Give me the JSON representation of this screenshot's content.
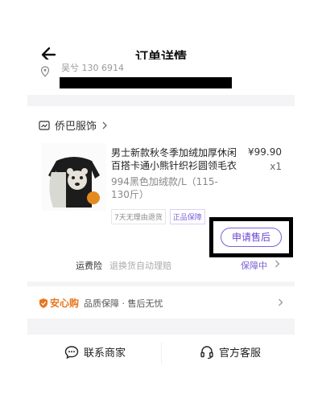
{
  "header": {
    "title": "订单详情"
  },
  "address": {
    "line": "吴兮 130 6914"
  },
  "store": {
    "name": "侨巴服饰"
  },
  "product": {
    "title": "男士新款秋冬季加绒加厚休闲百搭卡通小熊针织衫圆领毛衣",
    "price": "¥99.90",
    "qty": "x1",
    "spec": "994黑色加绒款/L（115-130斤）",
    "tags": [
      "7天无理由退货",
      "正品保障"
    ]
  },
  "actions": {
    "after_sale": "申请售后"
  },
  "insurance": {
    "label": "运费险",
    "desc": "退换货自动理赔",
    "status": "保障中"
  },
  "assurance": {
    "brand": "安心购",
    "text": "品质保障 · 售后无忧"
  },
  "footer": {
    "contact_merchant": "联系商家",
    "official_service": "官方客服"
  },
  "colors": {
    "accent": "#7d5fd6",
    "assure_orange": "#e8761c",
    "page_bg": "#f4f4f6"
  }
}
